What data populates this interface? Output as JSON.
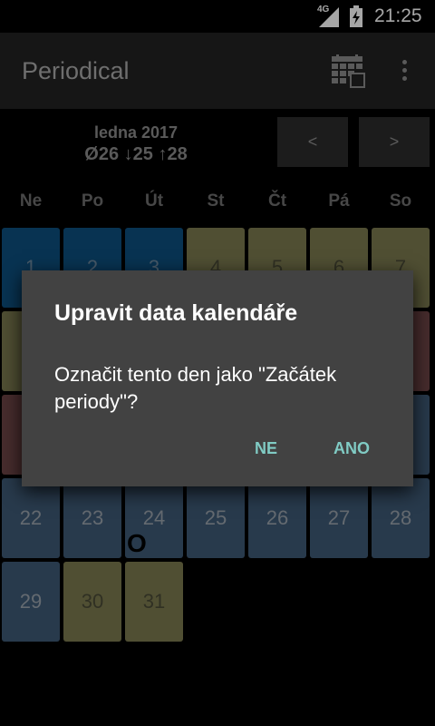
{
  "status_bar": {
    "network": "4G",
    "time": "21:25",
    "signal_icon": "signal-icon",
    "battery_icon": "battery-icon"
  },
  "app_bar": {
    "title": "Periodical",
    "calendar_icon": "calendar-icon",
    "menu_icon": "overflow-menu-icon"
  },
  "month_header": {
    "month": "ledna 2017",
    "stats": "Ø26 ↓25 ↑28",
    "prev_label": "<",
    "next_label": ">"
  },
  "weekdays": [
    "Ne",
    "Po",
    "Út",
    "St",
    "Čt",
    "Pá",
    "So"
  ],
  "days": [
    {
      "n": "1",
      "color": "#0d4f7e"
    },
    {
      "n": "2",
      "color": "#0d4f7e"
    },
    {
      "n": "3",
      "color": "#0d4f7e"
    },
    {
      "n": "4",
      "color": "#7b7a4f"
    },
    {
      "n": "5",
      "color": "#7b7a4f"
    },
    {
      "n": "6",
      "color": "#7b7a4f"
    },
    {
      "n": "7",
      "color": "#7b7a4f"
    },
    {
      "n": "22",
      "color": "#3e5a76"
    },
    {
      "n": "23",
      "color": "#3e5a76"
    },
    {
      "n": "24",
      "color": "#3e5a76",
      "marker": "O"
    },
    {
      "n": "25",
      "color": "#3e5a76"
    },
    {
      "n": "26",
      "color": "#3e5a76"
    },
    {
      "n": "27",
      "color": "#3e5a76"
    },
    {
      "n": "28",
      "color": "#3e5a76"
    },
    {
      "n": "29",
      "color": "#3e5a76"
    },
    {
      "n": "30",
      "color": "#7b7a4f"
    },
    {
      "n": "31",
      "color": "#7b7a4f"
    }
  ],
  "dialog": {
    "title": "Upravit data kalendáře",
    "message": "Označit tento den jako \"Začátek periody\"?",
    "negative": "NE",
    "positive": "ANO",
    "accent_color": "#80cbc4"
  }
}
